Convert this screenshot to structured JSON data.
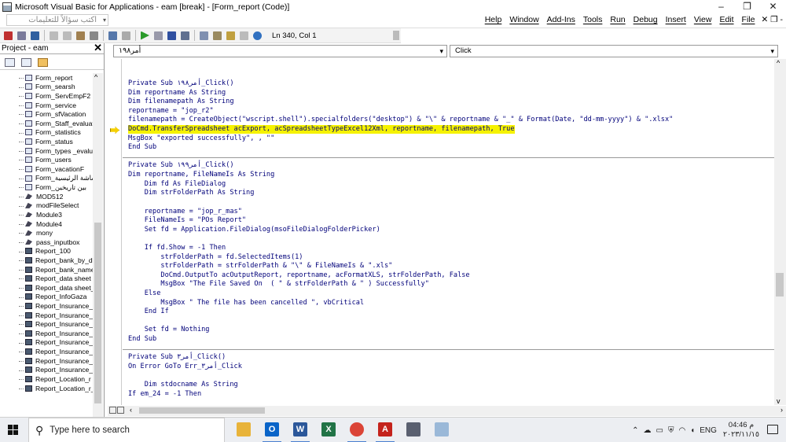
{
  "window": {
    "title": "Microsoft Visual Basic for Applications - eam [break] - [Form_report (Code)]",
    "controls": [
      "–",
      "❐",
      "✕"
    ]
  },
  "menubar": {
    "ask_placeholder": "اكتب سؤالاً للتعليمات",
    "menus": [
      "File",
      "Edit",
      "View",
      "Insert",
      "Debug",
      "Run",
      "Tools",
      "Add-Ins",
      "Window",
      "Help"
    ],
    "mdi_controls": "- ❐ ✕"
  },
  "toolbar": {
    "position": "Ln 340, Col 1"
  },
  "project": {
    "title": "Project - eam",
    "items": [
      {
        "label": "Form_report",
        "type": "form"
      },
      {
        "label": "Form_searsh",
        "type": "form"
      },
      {
        "label": "Form_ServEmpF2",
        "type": "form"
      },
      {
        "label": "Form_service",
        "type": "form"
      },
      {
        "label": "Form_sfVacation",
        "type": "form"
      },
      {
        "label": "Form_Staff_evaluati",
        "type": "form"
      },
      {
        "label": "Form_statistics",
        "type": "form"
      },
      {
        "label": "Form_status",
        "type": "form"
      },
      {
        "label": "Form_types _evalua",
        "type": "form"
      },
      {
        "label": "Form_users",
        "type": "form"
      },
      {
        "label": "Form_vacationF",
        "type": "form"
      },
      {
        "label": "Form_الشاشة الرئيسية",
        "type": "form"
      },
      {
        "label": "Form_بين تاريخين",
        "type": "form"
      },
      {
        "label": "MOD512",
        "type": "module"
      },
      {
        "label": "modFileSelect",
        "type": "module"
      },
      {
        "label": "Module3",
        "type": "module"
      },
      {
        "label": "Module4",
        "type": "module"
      },
      {
        "label": "mony",
        "type": "module"
      },
      {
        "label": "pass_inputbox",
        "type": "module"
      },
      {
        "label": "Report_100",
        "type": "report"
      },
      {
        "label": "Report_bank_by_da",
        "type": "report"
      },
      {
        "label": "Report_bank_name",
        "type": "report"
      },
      {
        "label": "Report_data sheet",
        "type": "report"
      },
      {
        "label": "Report_data sheet_",
        "type": "report"
      },
      {
        "label": "Report_InfoGaza",
        "type": "report"
      },
      {
        "label": "Report_Insurance_r",
        "type": "report"
      },
      {
        "label": "Report_Insurance_r",
        "type": "report"
      },
      {
        "label": "Report_Insurance_r",
        "type": "report"
      },
      {
        "label": "Report_Insurance_r",
        "type": "report"
      },
      {
        "label": "Report_Insurance_r",
        "type": "report"
      },
      {
        "label": "Report_Insurance_r",
        "type": "report"
      },
      {
        "label": "Report_Insurance_r",
        "type": "report"
      },
      {
        "label": "Report_Insurance_r",
        "type": "report"
      },
      {
        "label": "Report_Location_r",
        "type": "report"
      },
      {
        "label": "Report_Location_r_l",
        "type": "report"
      }
    ]
  },
  "editor": {
    "object_combo": "أمر١٩٨",
    "proc_combo": "Click",
    "blocks": [
      [
        "Private Sub أمر١٩٨_Click()",
        "Dim reportname As String",
        "Dim filenamepath As String",
        "reportname = \"jop_r2\"",
        "filenamepath = CreateObject(\"wscript.shell\").specialfolders(\"desktop\") & \"\\\" & reportname & \"_\" & Format(Date, \"dd-mm-yyyy\") & \".xlsx\"",
        "DoCmd.TransferSpreadsheet acExport, acSpreadsheetTypeExcel12Xml, reportname, filenamepath, True",
        "MsgBox \"exported successfully\", , \"\"",
        "End Sub"
      ],
      [
        "Private Sub أمر١٩٩_Click()",
        "Dim reportname, FileNameIs As String",
        "    Dim fd As FileDialog",
        "    Dim strFolderPath As String",
        "",
        "    reportname = \"jop_r_mas\"",
        "    FileNameIs = \"POs Report\"",
        "    Set fd = Application.FileDialog(msoFileDialogFolderPicker)",
        "",
        "    If fd.Show = -1 Then",
        "        strFolderPath = fd.SelectedItems(1)",
        "        strFolderPath = strFolderPath & \"\\\" & FileNameIs & \".xls\"",
        "        DoCmd.OutputTo acOutputReport, reportname, acFormatXLS, strFolderPath, False",
        "        MsgBox \"The File Saved On  ( \" & strFolderPath & \" ) Successfully\"",
        "    Else",
        "        MsgBox \" The file has been cancelled \", vbCritical",
        "    End If",
        "",
        "    Set fd = Nothing",
        "End Sub"
      ],
      [
        "Private Sub أمر٣_Click()",
        "On Error GoTo Err_أمر٣_Click",
        "",
        "    Dim stdocname As String",
        "If em_24 = -1 Then"
      ]
    ],
    "highlight_block": 0,
    "highlight_line": 5
  },
  "taskbar": {
    "search_placeholder": "Type here to search",
    "apps": [
      "file-explorer",
      "outlook",
      "word",
      "excel",
      "chrome",
      "acrobat",
      "calculator",
      "paint"
    ],
    "tray_lang": "ENG",
    "clock_time": "04:46 م",
    "clock_date": "٢٠٢٣/١١/١٥"
  }
}
